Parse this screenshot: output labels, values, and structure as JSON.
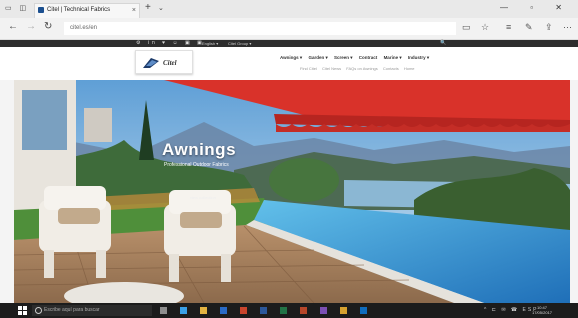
{
  "browser": {
    "tab_title": "Citel | Technical Fabrics",
    "tab_close": "×",
    "new_tab": "+",
    "tab_menu": "⌄",
    "url": "citel.es/en",
    "window_controls": "—  ▫  ✕"
  },
  "site": {
    "social_icons": "⚙ in ♥ ☺ ▣ ▣",
    "language": "English ▾",
    "group": "Citel Group ▾",
    "search_icon": "🔍",
    "logo_text": "Citel",
    "nav": [
      "Awnings ▾",
      "Garden ▾",
      "Screen ▾",
      "Contract",
      "Marine ▾",
      "Industry ▾"
    ],
    "sub_nav": [
      "Find Citel",
      "Citel News",
      "FAQs on Awnings",
      "Contacts",
      "Home"
    ]
  },
  "hero": {
    "title": "Awnings",
    "subtitle": "Professional Outdoor Fabrics",
    "link": "view collection"
  },
  "taskbar": {
    "search_placeholder": "Escribe aquí para buscar",
    "tray": "^ ⊏ ✉ ☎ ESP",
    "time": "10:47",
    "date": "17/05/2017"
  },
  "colors": {
    "awning_red": "#d9322a",
    "pool_blue": "#2f8fd4",
    "sky": "#7fb6de"
  }
}
